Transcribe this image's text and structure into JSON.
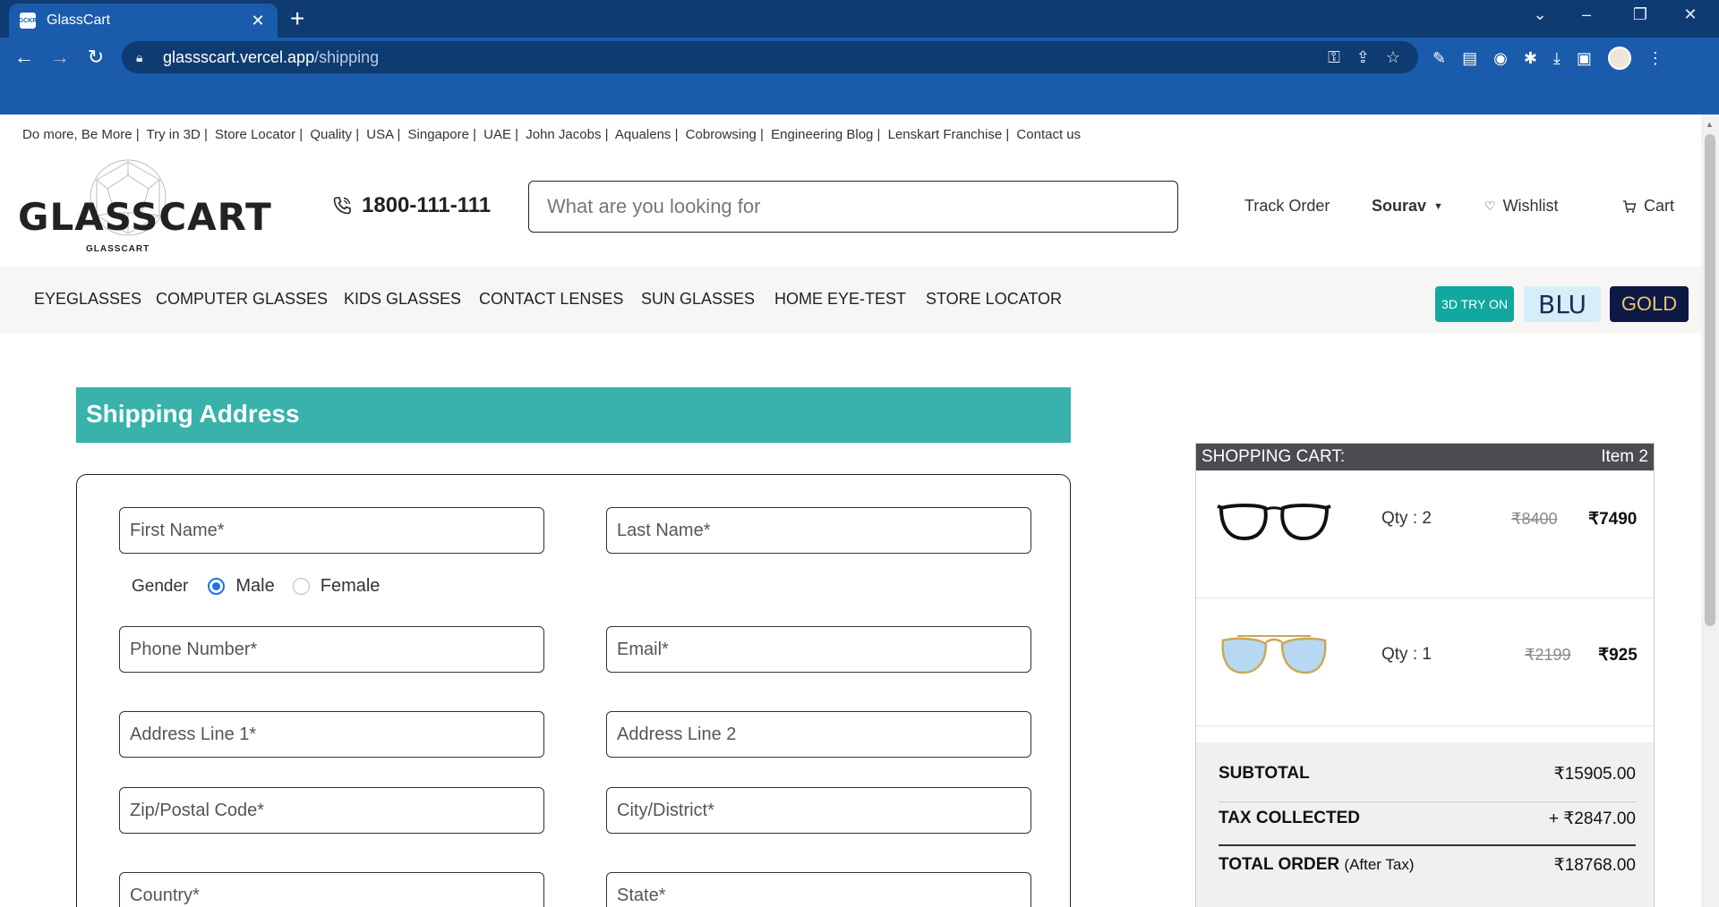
{
  "browser": {
    "tab_title": "GlassCart",
    "favicon_text": "GCKR",
    "url_host": "glassscart.vercel.app",
    "url_path": "/shipping"
  },
  "top_links": [
    "Do more, Be More |",
    "Try in 3D |",
    "Store Locator |",
    "Quality |",
    "USA |",
    "Singapore |",
    "UAE |",
    "John Jacobs |",
    "Aqualens |",
    "Cobrowsing |",
    "Engineering Blog |",
    "Lenskart Franchise |",
    "Contact us"
  ],
  "header": {
    "logo_text": "GLASSCART",
    "logo_sub": "GLASSCART",
    "phone": "1800-111-111",
    "search_placeholder": "What are you looking for",
    "track_order": "Track Order",
    "user": "Sourav",
    "wishlist": "Wishlist",
    "cart": "Cart"
  },
  "menu": [
    "EYEGLASSES",
    "COMPUTER GLASSES",
    "KIDS GLASSES",
    "CONTACT LENSES",
    "SUN GLASSES",
    "HOME EYE-TEST",
    "STORE LOCATOR"
  ],
  "badges": {
    "tryon": "3D TRY ON",
    "blu": "BLU",
    "gold": "GOLD"
  },
  "shipping": {
    "title": "Shipping Address",
    "fields": {
      "first_name": "First Name*",
      "last_name": "Last Name*",
      "phone": "Phone Number*",
      "email": "Email*",
      "address1": "Address Line 1*",
      "address2": "Address Line 2",
      "zip": "Zip/Postal Code*",
      "city": "City/District*",
      "country": "Country*",
      "state": "State*"
    },
    "gender_label": "Gender",
    "gender_options": [
      "Male",
      "Female"
    ],
    "gender_selected": "Male"
  },
  "cart": {
    "title": "SHOPPING CART:",
    "item_count": "Item 2",
    "items": [
      {
        "qty": "Qty : 2",
        "old_price": "₹8400",
        "price": "₹7490"
      },
      {
        "qty": "Qty : 1",
        "old_price": "₹2199",
        "price": "₹925"
      }
    ],
    "subtotal_label": "SUBTOTAL",
    "subtotal": "₹15905.00",
    "tax_label": "TAX COLLECTED",
    "tax": "+ ₹2847.00",
    "total_label": "TOTAL ORDER",
    "total_note": "(After Tax)",
    "total": "₹18768.00"
  },
  "colors": {
    "chrome_dark": "#0f3b73",
    "chrome": "#1b5bab",
    "teal": "#38b2ab",
    "tryon": "#11a89f",
    "gold_bg": "#0d1845"
  }
}
